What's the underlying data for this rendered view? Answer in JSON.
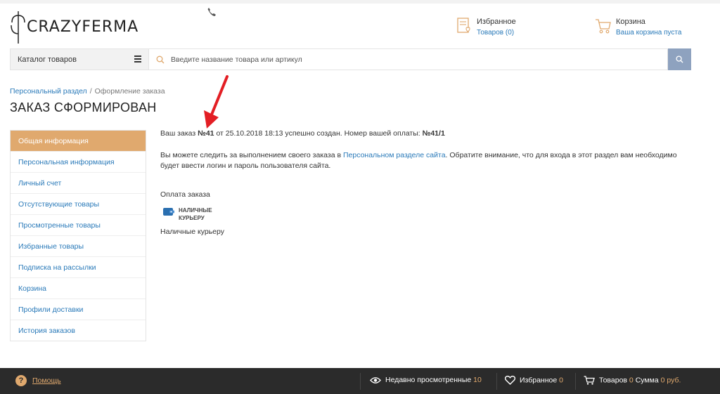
{
  "header": {
    "logo_text": "CRAZYFERMA",
    "favorites": {
      "title": "Избранное",
      "sub": "Товаров (0)"
    },
    "cart": {
      "title": "Корзина",
      "sub": "Ваша корзина пуста"
    },
    "catalog_label": "Каталог товаров",
    "search_placeholder": "Введите название товара или артикул"
  },
  "breadcrumb": {
    "parent": "Персональный раздел",
    "separator": "/",
    "current": "Оформление заказа"
  },
  "page_title": "ЗАКАЗ СФОРМИРОВАН",
  "sidebar": {
    "items": [
      {
        "label": "Общая информация",
        "active": true
      },
      {
        "label": "Персональная информация"
      },
      {
        "label": "Личный счет"
      },
      {
        "label": "Отсутствующие товары"
      },
      {
        "label": "Просмотренные товары"
      },
      {
        "label": "Избранные товары"
      },
      {
        "label": "Подписка на рассылки"
      },
      {
        "label": "Корзина"
      },
      {
        "label": "Профили доставки"
      },
      {
        "label": "История заказов"
      }
    ]
  },
  "order": {
    "prefix": "Ваш заказ",
    "number": "№41",
    "middle": "от 25.10.2018 18:13 успешно создан. Номер вашей оплаты:",
    "payment_number": "№41/1",
    "track_text_1": "Вы можете следить за выполнением своего заказа в",
    "track_link": "Персональном разделе сайта",
    "track_text_2": ". Обратите внимание, что для входа в этот раздел вам необходимо будет ввести логин и пароль пользователя сайта.",
    "payment_heading": "Оплата заказа",
    "payment_logo_line1": "НАЛИЧНЫЕ",
    "payment_logo_line2": "КУРЬЕРУ",
    "payment_method": "Наличные курьеру"
  },
  "footer": {
    "help": "Помощь",
    "recent_label": "Недавно просмотренные",
    "recent_count": "10",
    "fav_label": "Избранное",
    "fav_count": "0",
    "goods_label": "Товаров",
    "goods_count": "0",
    "sum_label": "Сумма",
    "sum_value": "0 руб."
  },
  "colors": {
    "accent": "#e0a96e",
    "link": "#2a7ab9",
    "search_button": "#8ea2bf",
    "footer_bg": "#2b2b2b",
    "arrow": "#e31e24"
  },
  "icons": [
    "phone-icon",
    "favorites-icon",
    "cart-icon",
    "menu-icon",
    "search-icon",
    "wallet-icon",
    "help-icon",
    "eye-icon",
    "heart-icon",
    "cart-small-icon"
  ]
}
